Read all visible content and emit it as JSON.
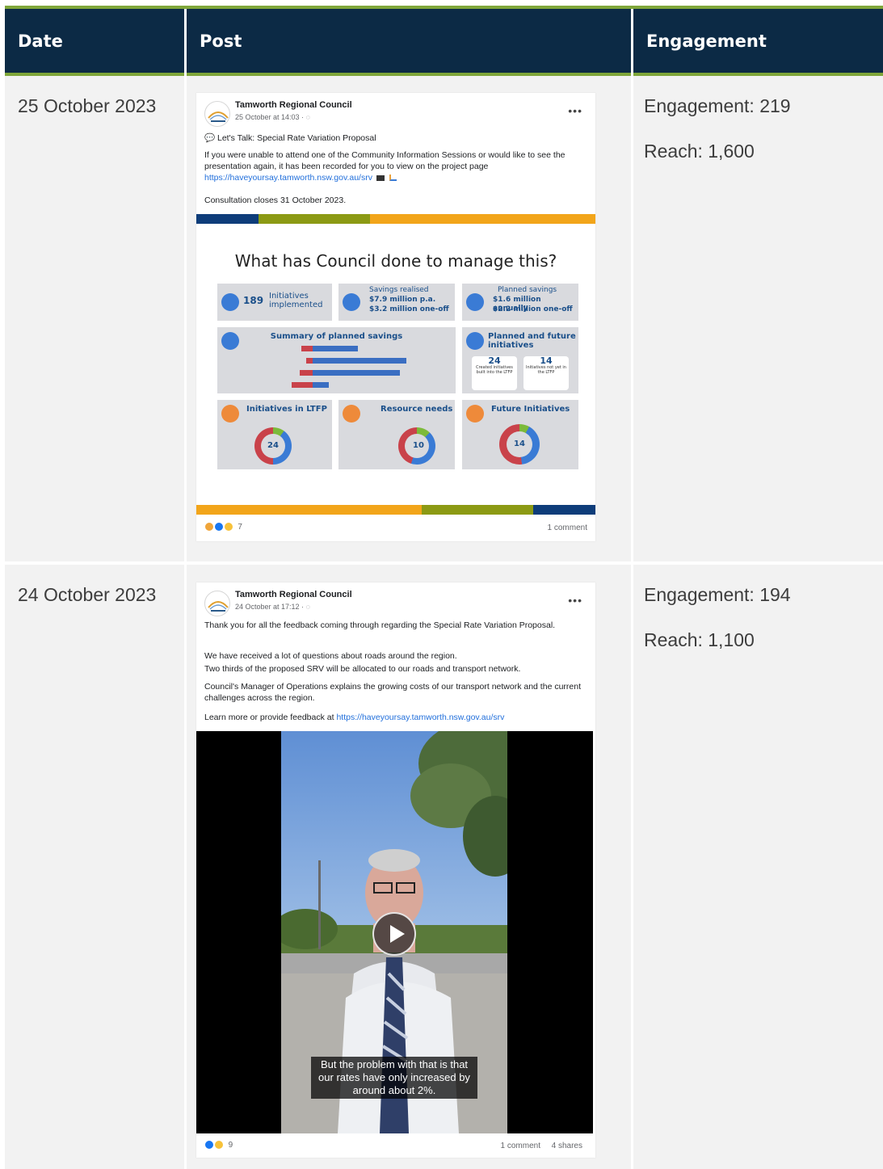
{
  "header": {
    "date_label": "Date",
    "post_label": "Post",
    "engagement_label": "Engagement"
  },
  "rows": [
    {
      "date": "25 October 2023",
      "engagement": "Engagement: 219",
      "reach": "Reach: 1,600",
      "post": {
        "page_name": "Tamworth Regional Council",
        "timestamp": "25 October at 14:03 · ",
        "headline": "Let's Talk: Special Rate Variation Proposal",
        "body": "If you were unable to attend one of the Community Information Sessions or would like to see the presentation again, it has been recorded for you to view on the project page",
        "link": "https://haveyoursay.tamworth.nsw.gov.au/srv",
        "closing": "Consultation closes 31 October 2023.",
        "reaction_count": "7",
        "comments": "1 comment",
        "infographic": {
          "title": "What has Council done to manage this?",
          "initiatives_count": "189",
          "initiatives_label": "Initiatives implemented",
          "savings_realised_label": "Savings realised",
          "savings_realised_1": "$7.9 million p.a.",
          "savings_realised_2": "$3.2 million one-off",
          "planned_savings_label": "Planned savings",
          "planned_savings_1": "$1.6 million annually",
          "planned_savings_2": "$2.2 million one-off",
          "summary_title": "Summary of planned savings",
          "planned_future_title": "Planned and future initiatives",
          "created_count": "24",
          "created_label": "Created initiatives built into the LTFP",
          "not_yet_count": "14",
          "not_yet_label": "Initiatives not yet in the LTFP",
          "ltfp_title": "Initiatives in LTFP",
          "ltfp_value": "24",
          "resource_title": "Resource needs",
          "resource_value": "10",
          "future_title": "Future Initiatives",
          "future_value": "14"
        }
      }
    },
    {
      "date": "24 October 2023",
      "engagement": "Engagement: 194",
      "reach": "Reach: 1,100",
      "post": {
        "page_name": "Tamworth Regional Council",
        "timestamp": "24 October at 17:12 · ",
        "para1": "Thank you for all the feedback coming through regarding the Special Rate Variation Proposal.",
        "para2a": "We have received a lot of questions about roads around the region.",
        "para2b": "Two thirds of the proposed SRV will be allocated to our roads and transport network.",
        "para3": "Council's Manager of Operations explains the growing costs of our transport network and the current challenges across the region.",
        "learn_more": "Learn more or provide feedback at ",
        "link": "https://haveyoursay.tamworth.nsw.gov.au/srv",
        "caption": "But the problem with that is that our rates have only increased by around about 2%.",
        "reaction_count": "9",
        "comments": "1 comment",
        "shares": "4 shares"
      }
    }
  ],
  "colors": {
    "header_bg": "#0c2a45",
    "accent_green": "#7fa63a",
    "stripe_blue": "#0e3d7a",
    "stripe_olive": "#8c9a14",
    "stripe_orange": "#f2a51a",
    "link": "#216fdb"
  }
}
